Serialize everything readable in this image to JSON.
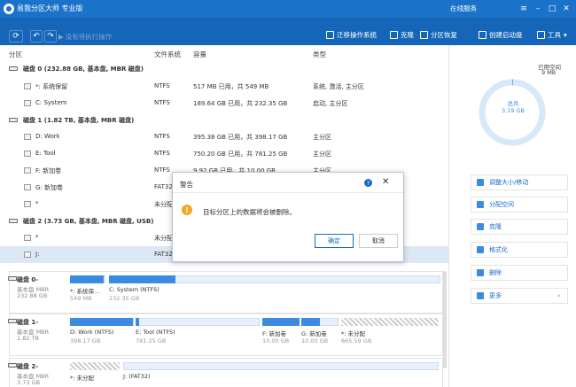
{
  "window": {
    "title": "易我分区大师 专业版",
    "online_service": "在线服务"
  },
  "toolbar": {
    "pending_label": "没有待执行操作",
    "tools": [
      "迁移操作系统",
      "克隆",
      "分区恢复",
      "创建启动盘",
      "工具"
    ]
  },
  "columns": {
    "partition": "分区",
    "fs": "文件系统",
    "capacity": "容量",
    "type": "类型"
  },
  "table_rows": [
    {
      "kind": "disk",
      "label": "磁盘 0 (232.88 GB, 基本盘, MBR 磁盘)"
    },
    {
      "kind": "part",
      "label": "*: 系统保留",
      "fs": "NTFS",
      "capacity": "517 MB   已用，共 549 MB",
      "type": "系统, 激活, 主分区"
    },
    {
      "kind": "part",
      "label": "C: System",
      "fs": "NTFS",
      "capacity": "189.64 GB 已用，共 232.35 GB",
      "type": "启动, 主分区"
    },
    {
      "kind": "disk",
      "label": "磁盘 1 (1.82 TB, 基本盘, MBR 磁盘)"
    },
    {
      "kind": "part",
      "label": "D: Work",
      "fs": "NTFS",
      "capacity": "395.38 GB 已用，共 398.17 GB",
      "type": "主分区"
    },
    {
      "kind": "part",
      "label": "E: Tool",
      "fs": "NTFS",
      "capacity": "750.20 GB 已用，共 781.25 GB",
      "type": "主分区"
    },
    {
      "kind": "part",
      "label": "F: 新加卷",
      "fs": "NTFS",
      "capacity": "9.92 GB  已用，共 10.00 GB",
      "type": "主分区"
    },
    {
      "kind": "part",
      "label": "G: 新加卷",
      "fs": "FAT32",
      "capacity": "",
      "type": ""
    },
    {
      "kind": "part",
      "label": "*",
      "fs": "未分配",
      "capacity": "",
      "type": ""
    },
    {
      "kind": "disk",
      "label": "磁盘 2 (3.73 GB, 基本盘, MBR 磁盘, USB)"
    },
    {
      "kind": "part",
      "label": "*",
      "fs": "未分配",
      "capacity": "",
      "type": ""
    },
    {
      "kind": "part",
      "label": "J:",
      "fs": "FAT32",
      "capacity": "",
      "type": "",
      "selected": true
    }
  ],
  "disk_maps": [
    {
      "name": "磁盘 0-",
      "sub": "基本盘 MBR",
      "size": "232.88 GB",
      "segments": [
        {
          "name": "*: 系统保...",
          "size": "549 MB",
          "fill": 0.95
        },
        {
          "name": "C: System (NTFS)",
          "size": "232.35 GB",
          "fill": 0.2
        }
      ]
    },
    {
      "name": "磁盘 1-",
      "sub": "基本盘 MBR",
      "size": "1.82 TB",
      "segments": [
        {
          "name": "D: Work (NTFS)",
          "size": "398.17 GB",
          "fill": 0.99
        },
        {
          "name": "E: Tool (NTFS)",
          "size": "781.25 GB",
          "fill": 0.03
        },
        {
          "name": "F: 新加卷",
          "size": "10.00 GB",
          "fill": 0.99
        },
        {
          "name": "G: 新加卷",
          "size": "10.00 GB",
          "fill": 0.5
        },
        {
          "name": "*: 未分配",
          "size": "665.59 GB",
          "fill": 0
        }
      ]
    },
    {
      "name": "磁盘 2-",
      "sub": "基本盘 MBR",
      "size": "3.73 GB",
      "segments": [
        {
          "name": "*: 未分配",
          "size": "",
          "fill": 0
        },
        {
          "name": "J: (FAT32)",
          "size": "",
          "fill": 0
        }
      ]
    }
  ],
  "summary": {
    "used_label": "已用空间",
    "used_value": "9 MB",
    "total_label": "总共",
    "total_value": "3.19 GB",
    "used_fraction": 0.003
  },
  "operations": [
    "调整大小/移动",
    "分配空间",
    "克隆",
    "格式化",
    "删除",
    "更多"
  ],
  "dialog": {
    "title": "警告",
    "message": "目标分区上的数据将会被删除。",
    "ok": "确定",
    "cancel": "取消"
  },
  "colors": {
    "accent": "#1a73c9",
    "toolbar": "#1565b8",
    "bar_fill": "#3c8be2",
    "warn": "#f5a623"
  }
}
